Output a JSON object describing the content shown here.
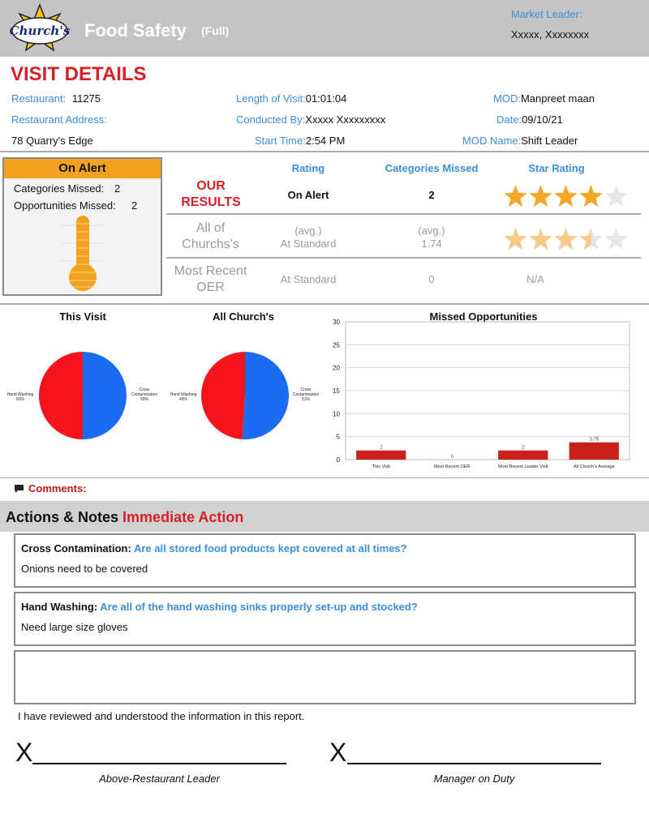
{
  "header": {
    "logo_text": "Church's",
    "title": "Food Safety",
    "subtitle": "(Full)",
    "market_leader_label": "Market Leader:",
    "market_leader_value": "Xxxxx, Xxxxxxxx"
  },
  "visit": {
    "section_title": "VISIT DETAILS",
    "restaurant_label": "Restaurant:",
    "restaurant_value": "11275",
    "address_label": "Restaurant Address:",
    "address_value": "78 Quarry's Edge",
    "length_label": "Length of Visit:",
    "length_value": "01:01:04",
    "conducted_label": "Conducted By:",
    "conducted_value": "Xxxxx Xxxxxxxxx",
    "start_label": "Start Time:",
    "start_value": "2:54 PM",
    "mod_label": "MOD:",
    "mod_value": "Manpreet maan",
    "date_label": "Date:",
    "date_value": "09/10/21",
    "modname_label": "MOD Name:",
    "modname_value": "Shift Leader"
  },
  "alert": {
    "status": "On Alert",
    "categories_label": "Categories Missed:",
    "categories_value": "2",
    "opportunities_label": "Opportunities Missed:",
    "opportunities_value": "2"
  },
  "results": {
    "headers": {
      "rating": "Rating",
      "categories": "Categories Missed",
      "stars": "Star Rating"
    },
    "rows": [
      {
        "label": "OUR RESULTS",
        "rating": "On Alert",
        "categories": "2",
        "stars": 4.0,
        "star_color": "#f5a623"
      },
      {
        "label": "All of Churchs's",
        "rating_prefix": "(avg.)",
        "rating": "At Standard",
        "categories_prefix": "(avg.)",
        "categories": "1.74",
        "stars": 3.5,
        "star_color": "#f8c989"
      },
      {
        "label": "Most Recent OER",
        "rating": "At Standard",
        "categories": "0",
        "stars_text": "N/A"
      }
    ]
  },
  "pies": [
    {
      "title": "This Visit",
      "left_label": "Hand Washing 50%",
      "right_label": "Cross Contamination 50%",
      "red": 50,
      "blue": 50
    },
    {
      "title": "All Church's",
      "left_label": "Hand Washing 49%",
      "right_label": "Cross Contamination 51%",
      "red": 49,
      "blue": 51
    }
  ],
  "chart_data": {
    "type": "bar",
    "title": "Missed Opportunities",
    "categories": [
      "This Visit",
      "Most Recent OER",
      "Most Recent Leader Visit",
      "All Church's Average"
    ],
    "values": [
      2,
      0,
      2,
      3.76
    ],
    "value_labels": [
      "2",
      "0",
      "2",
      "3.76"
    ],
    "ylim": [
      0,
      30
    ],
    "yticks": [
      0,
      5,
      10,
      15,
      20,
      25,
      30
    ],
    "grid": true,
    "bar_color": "#c9201a"
  },
  "comments": {
    "label": "Comments:"
  },
  "actions": {
    "title": "Actions & Notes",
    "title_highlight": "Immediate Action",
    "notes": [
      {
        "category": "Cross Contamination:",
        "question": "Are all stored food products kept covered at all times?",
        "answer": "Onions need to be covered"
      },
      {
        "category": "Hand Washing:",
        "question": "Are all of the hand washing sinks properly set-up and stocked?",
        "answer": "Need large size gloves"
      }
    ]
  },
  "acknowledgement": "I have reviewed and understood the information in this report.",
  "signatures": [
    {
      "mark": "X",
      "caption": "Above-Restaurant Leader"
    },
    {
      "mark": "X",
      "caption": "Manager on Duty"
    }
  ]
}
